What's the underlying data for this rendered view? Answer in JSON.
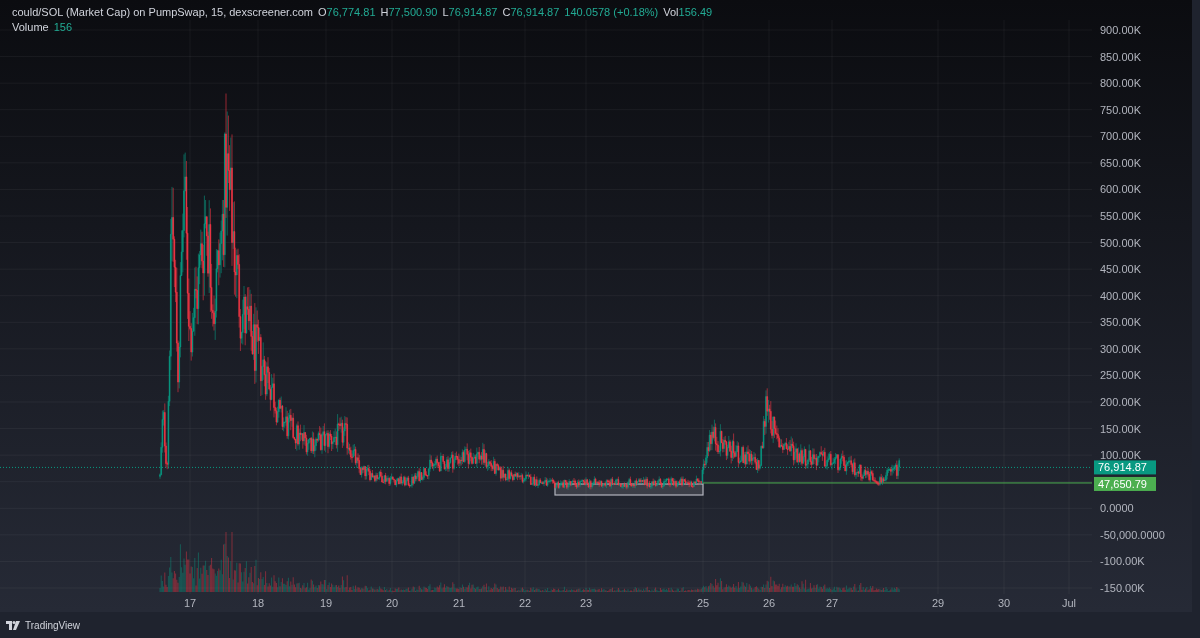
{
  "legend": {
    "symbol": "could/SOL (Market Cap) on PumpSwap, 15, dexscreener.com",
    "values": [
      {
        "label": "O",
        "value": "76,774.81"
      },
      {
        "label": "H",
        "value": "77,500.90"
      },
      {
        "label": "L",
        "value": "76,914.87"
      },
      {
        "label": "C",
        "value": "76,914.87"
      }
    ],
    "change": "140.0578 (+0.18%)",
    "vol_label": "Vol",
    "vol": "156.49"
  },
  "volume_legend": {
    "label": "Volume",
    "value": "156"
  },
  "y_axis": {
    "ticks": [
      "900.00K",
      "850.00K",
      "800.00K",
      "750.00K",
      "700.00K",
      "650.00K",
      "600.00K",
      "550.00K",
      "500.00K",
      "450.00K",
      "400.00K",
      "350.00K",
      "300.00K",
      "250.00K",
      "200.00K",
      "150.00K",
      "100.00K",
      "0.0000",
      "-50,000.0000",
      "-100.00K",
      "-150.00K"
    ]
  },
  "price_labels": [
    {
      "text": "76,914.87",
      "color": "#089981"
    },
    {
      "text": "47,650.79",
      "color": "#4caf50"
    }
  ],
  "x_axis": {
    "ticks": [
      "17",
      "18",
      "19",
      "20",
      "21",
      "22",
      "23",
      "25",
      "26",
      "27",
      "29",
      "30",
      "Jul"
    ]
  },
  "footer": {
    "brand": "TradingView"
  }
}
